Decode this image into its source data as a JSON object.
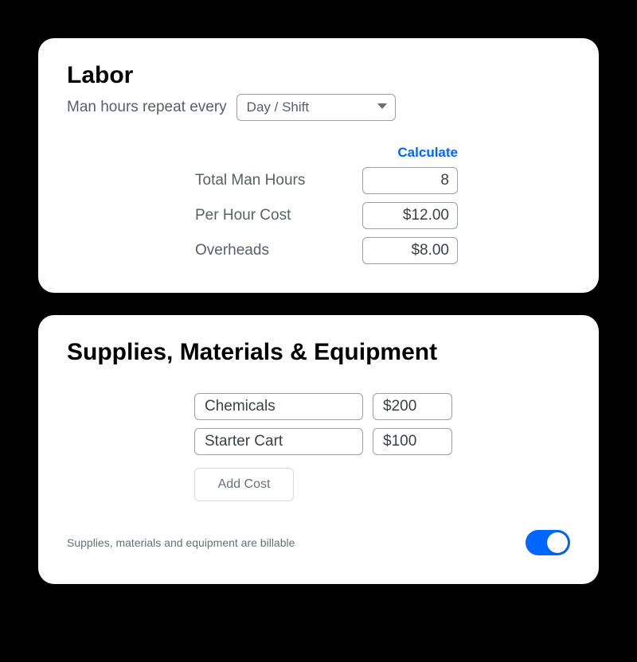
{
  "labor": {
    "title": "Labor",
    "repeat_label": "Man hours repeat every",
    "repeat_value": "Day / Shift",
    "calculate_label": "Calculate",
    "rows": [
      {
        "label": "Total Man Hours",
        "value": "8"
      },
      {
        "label": "Per Hour Cost",
        "value": "$12.00"
      },
      {
        "label": "Overheads",
        "value": "$8.00"
      }
    ]
  },
  "supplies": {
    "title": "Supplies, Materials & Equipment",
    "items": [
      {
        "name": "Chemicals",
        "cost": "$200"
      },
      {
        "name": "Starter Cart",
        "cost": "$100"
      }
    ],
    "add_cost_label": "Add Cost",
    "billable_label": "Supplies, materials and equipment are billable",
    "billable_on": true
  }
}
